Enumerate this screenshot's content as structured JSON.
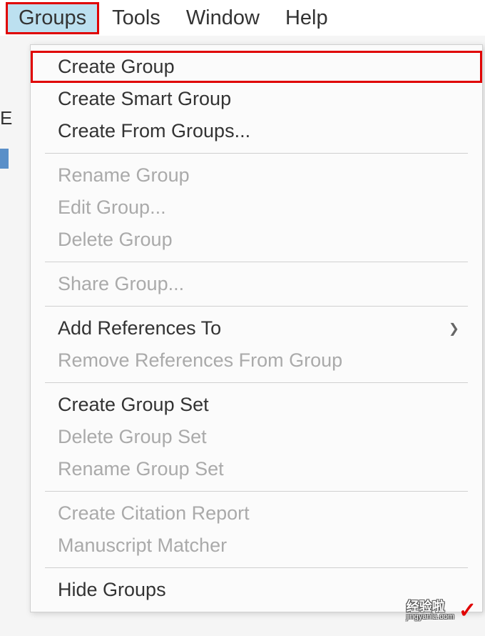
{
  "menubar": {
    "groups": "Groups",
    "tools": "Tools",
    "window": "Window",
    "help": "Help"
  },
  "dropdown": {
    "items": [
      {
        "label": "Create Group",
        "enabled": true,
        "highlighted": true
      },
      {
        "label": "Create Smart Group",
        "enabled": true
      },
      {
        "label": "Create From Groups...",
        "enabled": true
      },
      {
        "separator": true
      },
      {
        "label": "Rename Group",
        "enabled": false
      },
      {
        "label": "Edit Group...",
        "enabled": false
      },
      {
        "label": "Delete Group",
        "enabled": false
      },
      {
        "separator": true
      },
      {
        "label": "Share Group...",
        "enabled": false
      },
      {
        "separator": true
      },
      {
        "label": "Add References To",
        "enabled": true,
        "submenu": true
      },
      {
        "label": "Remove References From Group",
        "enabled": false
      },
      {
        "separator": true
      },
      {
        "label": "Create Group Set",
        "enabled": true
      },
      {
        "label": "Delete Group Set",
        "enabled": false
      },
      {
        "label": "Rename Group Set",
        "enabled": false
      },
      {
        "separator": true
      },
      {
        "label": "Create Citation Report",
        "enabled": false
      },
      {
        "label": "Manuscript Matcher",
        "enabled": false
      },
      {
        "separator": true
      },
      {
        "label": "Hide Groups",
        "enabled": true
      }
    ]
  },
  "left_edge_text": "E",
  "watermark": {
    "main": "经验啦",
    "sub": "jingyanla.com",
    "check": "✓"
  }
}
